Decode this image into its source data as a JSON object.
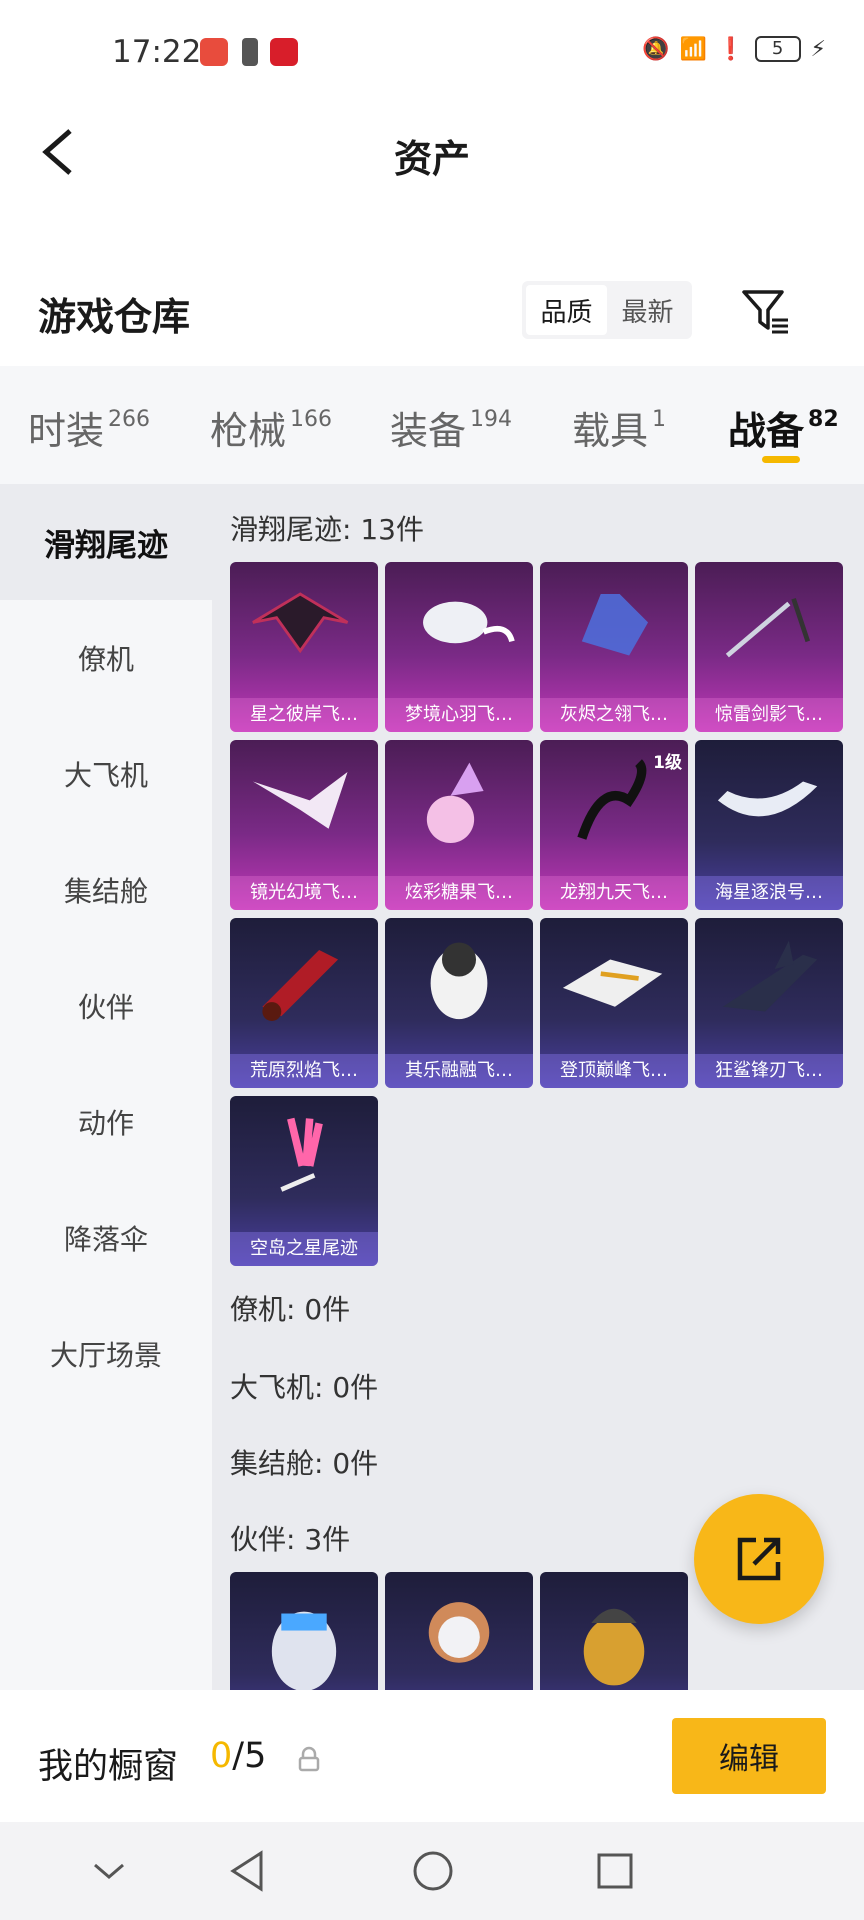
{
  "status_bar": {
    "time": "17:22",
    "battery": "5"
  },
  "header": {
    "title": "资产"
  },
  "warehouse": {
    "title": "游戏仓库",
    "sort_options": [
      "品质",
      "最新"
    ],
    "active_sort": "品质"
  },
  "tabs": [
    {
      "label": "时装",
      "count": "266"
    },
    {
      "label": "枪械",
      "count": "166"
    },
    {
      "label": "装备",
      "count": "194"
    },
    {
      "label": "载具",
      "count": "1"
    },
    {
      "label": "战备",
      "count": "82"
    }
  ],
  "active_tab": "战备",
  "sidebar": [
    "滑翔尾迹",
    "僚机",
    "大飞机",
    "集结舱",
    "伙伴",
    "动作",
    "降落伞",
    "大厅场景"
  ],
  "active_sidebar": "滑翔尾迹",
  "groups": {
    "glide": {
      "title": "滑翔尾迹: 13件",
      "items": [
        {
          "name": "星之彼岸飞…",
          "rarity": "purple",
          "icon": "dark-wing-glider-icon"
        },
        {
          "name": "梦境心羽飞…",
          "rarity": "purple",
          "icon": "white-feather-glider-icon"
        },
        {
          "name": "灰烬之翎飞…",
          "rarity": "purple",
          "icon": "blue-hand-glider-icon"
        },
        {
          "name": "惊雷剑影飞…",
          "rarity": "purple",
          "icon": "sword-glider-icon"
        },
        {
          "name": "镜光幻境飞…",
          "rarity": "purple",
          "icon": "crystal-wing-glider-icon"
        },
        {
          "name": "炫彩糖果飞…",
          "rarity": "purple",
          "icon": "candy-glider-icon"
        },
        {
          "name": "龙翔九天飞…",
          "rarity": "purple",
          "icon": "dragon-glider-icon",
          "badge": "1级"
        },
        {
          "name": "海星逐浪号…",
          "rarity": "blue",
          "icon": "boat-glider-icon"
        },
        {
          "name": "荒原烈焰飞…",
          "rarity": "blue",
          "icon": "flame-glider-icon"
        },
        {
          "name": "其乐融融飞…",
          "rarity": "blue",
          "icon": "penguin-glider-icon"
        },
        {
          "name": "登顶巅峰飞…",
          "rarity": "blue",
          "icon": "jet-glider-icon"
        },
        {
          "name": "狂鲨锋刃飞…",
          "rarity": "blue",
          "icon": "shark-glider-icon"
        },
        {
          "name": "空岛之星尾迹",
          "rarity": "blue",
          "icon": "rainbow-trail-icon"
        }
      ]
    },
    "wingman": {
      "title": "僚机: 0件"
    },
    "bigplane": {
      "title": "大飞机: 0件"
    },
    "capsule": {
      "title": "集结舱: 0件"
    },
    "companion": {
      "title": "伙伴: 3件",
      "items": [
        {
          "name": "",
          "rarity": "blue",
          "icon": "cat-companion-icon"
        },
        {
          "name": "",
          "rarity": "blue",
          "icon": "sheep-companion-icon"
        },
        {
          "name": "",
          "rarity": "blue",
          "icon": "chicken-companion-icon"
        }
      ]
    }
  },
  "showcase": {
    "label": "我的橱窗",
    "current": "0",
    "total": "/5",
    "edit_label": "编辑"
  },
  "colors": {
    "accent": "#f8b718",
    "purple_card": "#7a2a86",
    "blue_card": "#2f2c5c"
  }
}
